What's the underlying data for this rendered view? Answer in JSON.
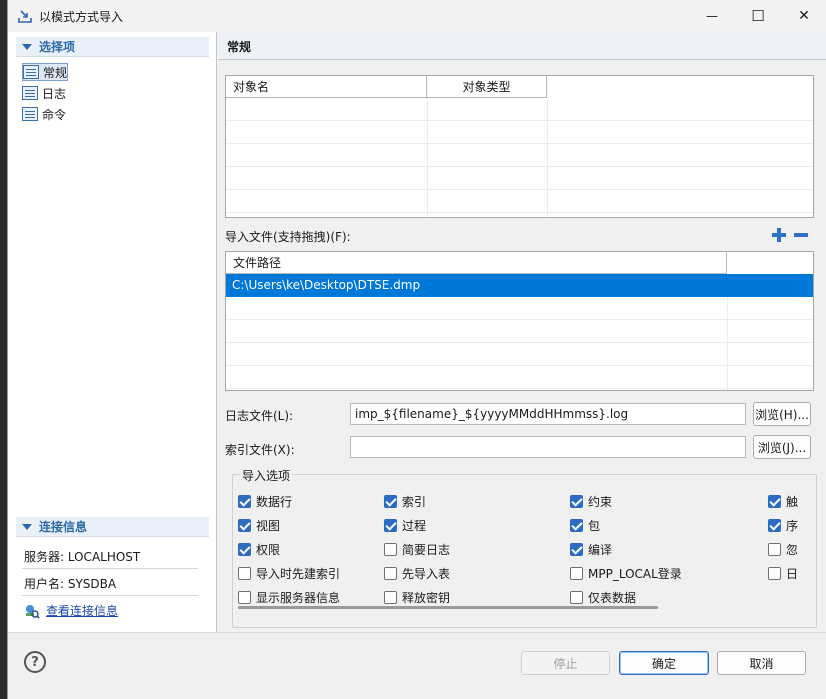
{
  "window": {
    "title": "以模式方式导入",
    "minimize_glyph": "—",
    "maximize_glyph": "☐",
    "close_glyph": "✕"
  },
  "sidebar": {
    "section_title": "选择项",
    "items": [
      {
        "label": "常规",
        "selected": true
      },
      {
        "label": "日志",
        "selected": false
      },
      {
        "label": "命令",
        "selected": false
      }
    ],
    "conn_title": "连接信息",
    "server": "服务器: LOCALHOST",
    "user": "用户名: SYSDBA",
    "view_conn": "查看连接信息"
  },
  "main": {
    "header": "常规",
    "objects_table": {
      "columns": [
        "对象名",
        "对象类型"
      ],
      "rows": []
    },
    "import_files_label": "导入文件(支持拖拽)(F):",
    "files_table": {
      "columns": [
        "文件路径"
      ],
      "rows": [
        "C:\\Users\\ke\\Desktop\\DTSE.dmp"
      ]
    },
    "log_label": "日志文件(L):",
    "log_value": "imp_${filename}_${yyyyMMddHHmmss}.log",
    "browse_log": "浏览(H)...",
    "index_label": "索引文件(X):",
    "index_value": "",
    "browse_index": "浏览(J)...",
    "options_title": "导入选项",
    "options": [
      {
        "label": "数据行",
        "checked": true
      },
      {
        "label": "索引",
        "checked": true
      },
      {
        "label": "约束",
        "checked": true
      },
      {
        "label": "触",
        "checked": true
      },
      {
        "label": "视图",
        "checked": true
      },
      {
        "label": "过程",
        "checked": true
      },
      {
        "label": "包",
        "checked": true
      },
      {
        "label": "序",
        "checked": true
      },
      {
        "label": "权限",
        "checked": true
      },
      {
        "label": "简要日志",
        "checked": false
      },
      {
        "label": "编译",
        "checked": true
      },
      {
        "label": "忽",
        "checked": false
      },
      {
        "label": "导入时先建索引",
        "checked": false
      },
      {
        "label": "先导入表",
        "checked": false
      },
      {
        "label": "MPP_LOCAL登录",
        "checked": false
      },
      {
        "label": "日",
        "checked": false
      },
      {
        "label": "显示服务器信息",
        "checked": false
      },
      {
        "label": "释放密钥",
        "checked": false
      },
      {
        "label": "仅表数据",
        "checked": false
      }
    ]
  },
  "footer": {
    "help": "?",
    "stop": "停止",
    "ok": "确定",
    "cancel": "取消"
  },
  "colors": {
    "accent": "#0078d7",
    "selected_row": "#0078d7",
    "check": "#2b6bc4",
    "section_text": "#2d6aa8"
  }
}
